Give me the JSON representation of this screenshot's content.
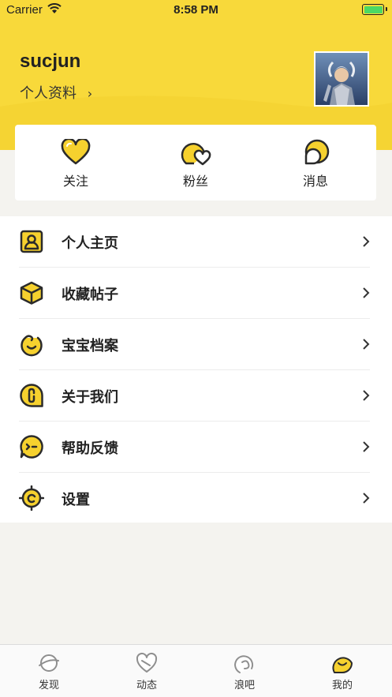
{
  "status_bar": {
    "carrier": "Carrier",
    "time": "8:58 PM"
  },
  "header": {
    "username": "sucjun",
    "profile_link": "个人资料",
    "avatar": "user-avatar"
  },
  "stats": [
    {
      "label": "关注",
      "icon": "heart-icon"
    },
    {
      "label": "粉丝",
      "icon": "fans-icon"
    },
    {
      "label": "消息",
      "icon": "message-icon"
    }
  ],
  "menu": [
    {
      "label": "个人主页",
      "icon": "profile-page-icon"
    },
    {
      "label": "收藏帖子",
      "icon": "box-icon"
    },
    {
      "label": "宝宝档案",
      "icon": "baby-icon"
    },
    {
      "label": "关于我们",
      "icon": "about-icon"
    },
    {
      "label": "帮助反馈",
      "icon": "feedback-icon"
    },
    {
      "label": "设置",
      "icon": "settings-icon"
    }
  ],
  "tabbar": [
    {
      "label": "发现",
      "icon": "planet-icon"
    },
    {
      "label": "动态",
      "icon": "heart-outline-icon"
    },
    {
      "label": "浪吧",
      "icon": "wave-icon"
    },
    {
      "label": "我的",
      "icon": "smile-face-icon",
      "active": true
    }
  ],
  "colors": {
    "accent": "#f8d93a",
    "icon_fill": "#f6d12e",
    "icon_stroke": "#2b2b2b",
    "battery": "#4cd964"
  }
}
